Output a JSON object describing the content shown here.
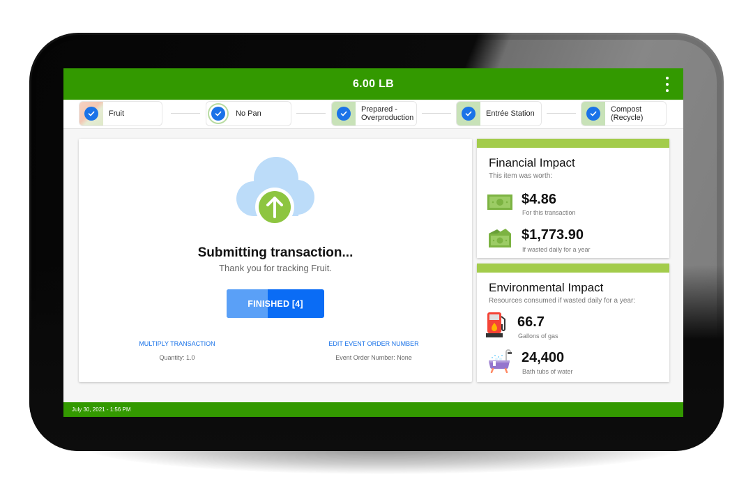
{
  "header": {
    "weight": "6.00 LB",
    "menu_icon": "more-vertical-icon"
  },
  "steps": [
    {
      "label": "Fruit",
      "style": "fruit-thumbnail",
      "completed": true
    },
    {
      "label": "No Pan",
      "style": "ring",
      "completed": true
    },
    {
      "label": "Prepared -\nOverproduction",
      "style": "green",
      "completed": true
    },
    {
      "label": "Entrée Station",
      "style": "green",
      "completed": true
    },
    {
      "label": "Compost\n(Recycle)",
      "style": "green",
      "completed": true
    }
  ],
  "main": {
    "icon": "cloud-upload-icon",
    "title": "Submitting transaction...",
    "subtitle": "Thank you for tracking Fruit.",
    "finish_button": "FINISHED [4]",
    "finish_progress": 0.42,
    "multiply": {
      "label": "MULTIPLY TRANSACTION",
      "value": "Quantity: 1.0"
    },
    "event_order": {
      "label": "EDIT EVENT ORDER NUMBER",
      "value": "Event Order Number: None"
    }
  },
  "financial": {
    "title": "Financial Impact",
    "desc": "This item was worth:",
    "metrics": [
      {
        "icon": "cash-bill-icon",
        "value": "$4.86",
        "caption": "For this transaction"
      },
      {
        "icon": "cash-stack-icon",
        "value": "$1,773.90",
        "caption": "If wasted daily for a year"
      }
    ]
  },
  "environmental": {
    "title": "Environmental Impact",
    "desc": "Resources consumed if wasted daily for a year:",
    "metrics": [
      {
        "icon": "gas-pump-icon",
        "value": "66.7",
        "caption": "Gallons of gas"
      },
      {
        "icon": "bathtub-icon",
        "value": "24,400",
        "caption": "Bath tubs of water"
      }
    ]
  },
  "footer": {
    "timestamp": "July 30, 2021 - 1:56 PM"
  },
  "colors": {
    "brand_green": "#339900",
    "accent_lime": "#a3cc4b",
    "primary_blue": "#0a6cf5",
    "link_blue": "#1a73e8"
  }
}
